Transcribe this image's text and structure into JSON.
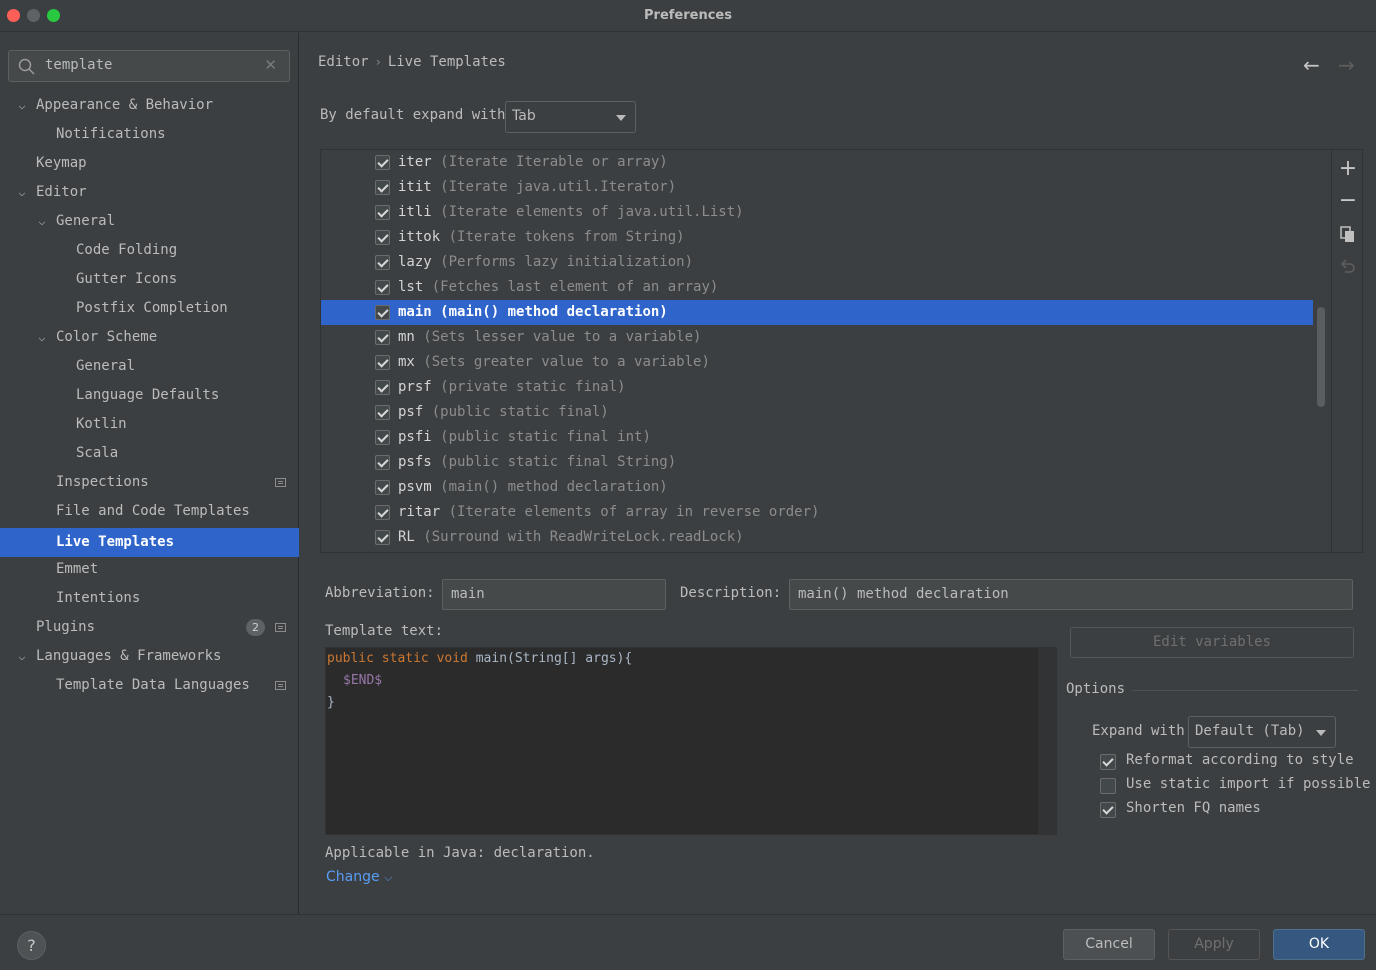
{
  "window": {
    "title": "Preferences"
  },
  "sidebar": {
    "search": {
      "value": "template"
    },
    "items": [
      {
        "label": "Appearance & Behavior",
        "expanded": true
      },
      {
        "label": "Notifications"
      },
      {
        "label": "Keymap"
      },
      {
        "label": "Editor",
        "expanded": true
      },
      {
        "label": "General",
        "expanded": true
      },
      {
        "label": "Code Folding"
      },
      {
        "label": "Gutter Icons"
      },
      {
        "label": "Postfix Completion"
      },
      {
        "label": "Color Scheme",
        "expanded": true
      },
      {
        "label": "General"
      },
      {
        "label": "Language Defaults"
      },
      {
        "label": "Kotlin"
      },
      {
        "label": "Scala"
      },
      {
        "label": "Inspections"
      },
      {
        "label": "File and Code Templates"
      },
      {
        "label": "Live Templates",
        "selected": true
      },
      {
        "label": "Emmet"
      },
      {
        "label": "Intentions"
      },
      {
        "label": "Plugins",
        "badge": "2"
      },
      {
        "label": "Languages & Frameworks",
        "expanded": true
      },
      {
        "label": "Template Data Languages"
      }
    ]
  },
  "header": {
    "breadcrumb": [
      "Editor",
      "Live Templates"
    ],
    "breadcrumb_sep": "›"
  },
  "expand": {
    "label": "By default expand with",
    "value": "Tab"
  },
  "templates": [
    {
      "abbr": "iter",
      "desc": "(Iterate Iterable or array)",
      "checked": true
    },
    {
      "abbr": "itit",
      "desc": "(Iterate java.util.Iterator)",
      "checked": true
    },
    {
      "abbr": "itli",
      "desc": "(Iterate elements of java.util.List)",
      "checked": true
    },
    {
      "abbr": "ittok",
      "desc": "(Iterate tokens from String)",
      "checked": true
    },
    {
      "abbr": "lazy",
      "desc": "(Performs lazy initialization)",
      "checked": true
    },
    {
      "abbr": "lst",
      "desc": "(Fetches last element of an array)",
      "checked": true
    },
    {
      "abbr": "main",
      "desc": "(main() method declaration)",
      "checked": true,
      "selected": true
    },
    {
      "abbr": "mn",
      "desc": "(Sets lesser value to a variable)",
      "checked": true
    },
    {
      "abbr": "mx",
      "desc": "(Sets greater value to a variable)",
      "checked": true
    },
    {
      "abbr": "prsf",
      "desc": "(private static final)",
      "checked": true
    },
    {
      "abbr": "psf",
      "desc": "(public static final)",
      "checked": true
    },
    {
      "abbr": "psfi",
      "desc": "(public static final int)",
      "checked": true
    },
    {
      "abbr": "psfs",
      "desc": "(public static final String)",
      "checked": true
    },
    {
      "abbr": "psvm",
      "desc": "(main() method declaration)",
      "checked": true
    },
    {
      "abbr": "ritar",
      "desc": "(Iterate elements of array in reverse order)",
      "checked": true
    },
    {
      "abbr": "RL",
      "desc": "(Surround with ReadWriteLock.readLock)",
      "checked": true
    }
  ],
  "toolbar": {
    "add": "+",
    "remove": "−",
    "copy": "copy-icon",
    "restore": "restore-icon"
  },
  "details": {
    "abbreviation_label": "Abbreviation:",
    "abbreviation_value": "main",
    "description_label": "Description:",
    "description_value": "main() method declaration",
    "template_text_label": "Template text:",
    "code": {
      "line1_kw": "public static void ",
      "line1_rest": "main(String[] args){",
      "line2_var": "$END$",
      "line3": "}"
    },
    "edit_variables": "Edit variables",
    "applicable": "Applicable in Java: declaration.",
    "change": "Change"
  },
  "options": {
    "title": "Options",
    "expand_label": "Expand with",
    "expand_value": "Default (Tab)",
    "reformat": {
      "label": "Reformat according to style",
      "checked": true
    },
    "static_import": {
      "label": "Use static import if possible",
      "checked": false
    },
    "shorten_fq": {
      "label": "Shorten FQ names",
      "checked": true
    }
  },
  "footer": {
    "help": "?",
    "cancel": "Cancel",
    "apply": "Apply",
    "ok": "OK"
  },
  "colors": {
    "accent": "#2f65ca",
    "background": "#3c3f41",
    "editor_bg": "#2b2b2b",
    "link": "#589df6"
  }
}
